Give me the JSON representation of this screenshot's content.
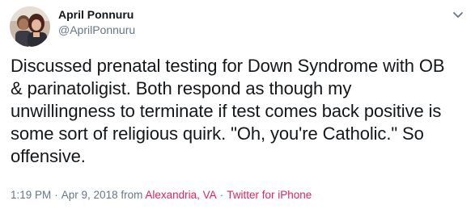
{
  "author": {
    "display_name": "April Ponnuru",
    "screen_name": "@AprilPonnuru"
  },
  "tweet": {
    "lines": [
      "Discussed prenatal testing for Down Syndrome with OB",
      "& parinatoligist. Both respond as though my",
      "unwillingness to terminate if test comes back positive is",
      "some sort of religious quirk. \"Oh, you're Catholic.\" So",
      "offensive."
    ]
  },
  "meta": {
    "time": "1:19 PM",
    "separator": "·",
    "date": "Apr 9, 2018",
    "from_label": "from",
    "location": "Alexandria, VA",
    "client": "Twitter for iPhone"
  },
  "icons": {
    "menu": "chevron-down-icon"
  },
  "colors": {
    "link": "#e0245e",
    "secondary_text": "#657786",
    "primary_text": "#14171a"
  }
}
